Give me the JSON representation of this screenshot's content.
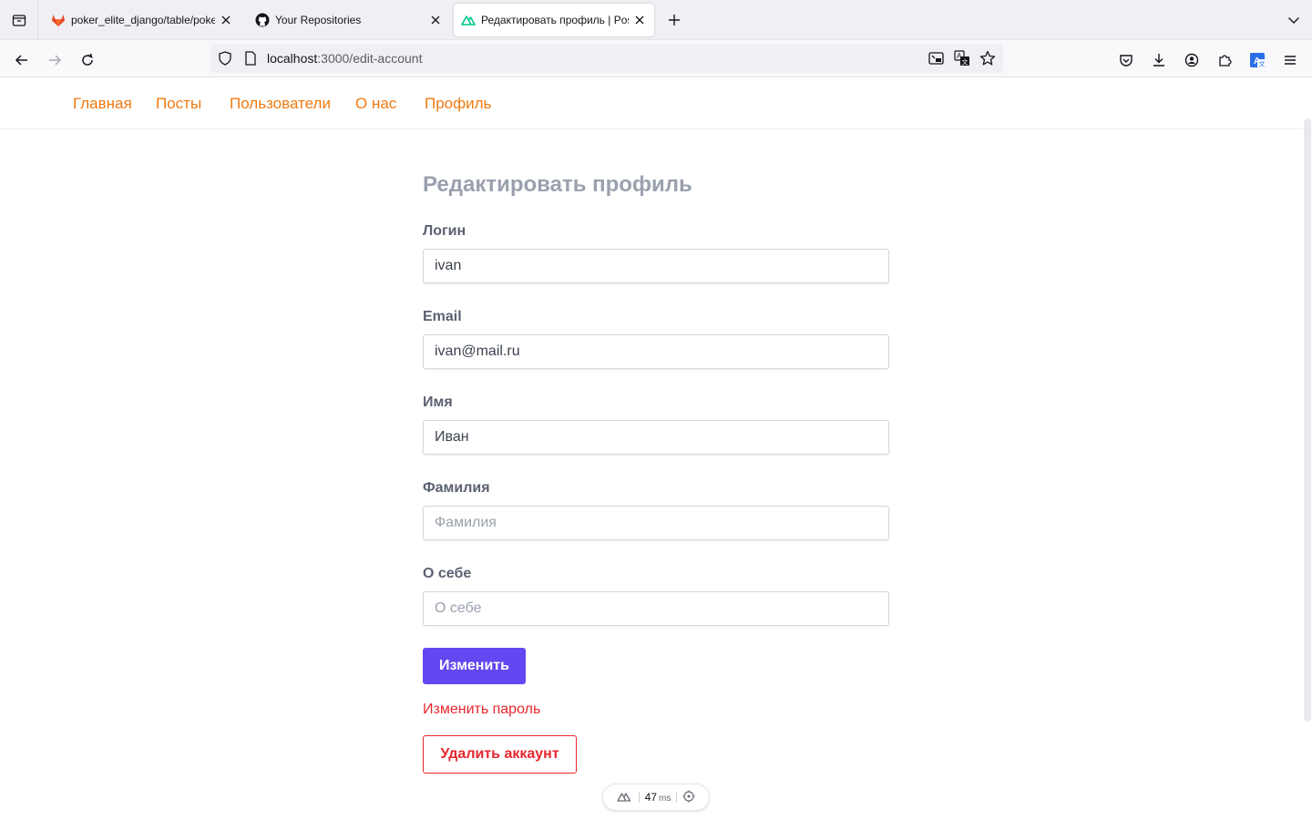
{
  "browser": {
    "tabs": [
      {
        "title": "poker_elite_django/table/poker_",
        "favicon": "gitlab-icon"
      },
      {
        "title": "Your Repositories",
        "favicon": "github-icon"
      },
      {
        "title": "Редактировать профиль | Post",
        "favicon": "nuxt-icon",
        "active": true
      }
    ],
    "url_host": "localhost",
    "url_path": ":3000/edit-account"
  },
  "site_nav": {
    "items": [
      "Главная",
      "Посты",
      "Пользователи",
      "О нас",
      "Профиль"
    ],
    "color": "#f07a12"
  },
  "form": {
    "title": "Редактировать профиль",
    "fields": [
      {
        "label": "Логин",
        "value": "ivan",
        "placeholder": ""
      },
      {
        "label": "Email",
        "value": "ivan@mail.ru",
        "placeholder": ""
      },
      {
        "label": "Имя",
        "value": "Иван",
        "placeholder": ""
      },
      {
        "label": "Фамилия",
        "value": "",
        "placeholder": "Фамилия"
      },
      {
        "label": "О себе",
        "value": "",
        "placeholder": "О себе"
      }
    ],
    "submit_label": "Изменить",
    "change_password_label": "Изменить пароль",
    "delete_label": "Удалить аккаунт",
    "accent_color": "#6248f0",
    "danger_color": "#e8262e"
  },
  "devtools": {
    "ms_value": "47",
    "ms_unit": "ms"
  }
}
